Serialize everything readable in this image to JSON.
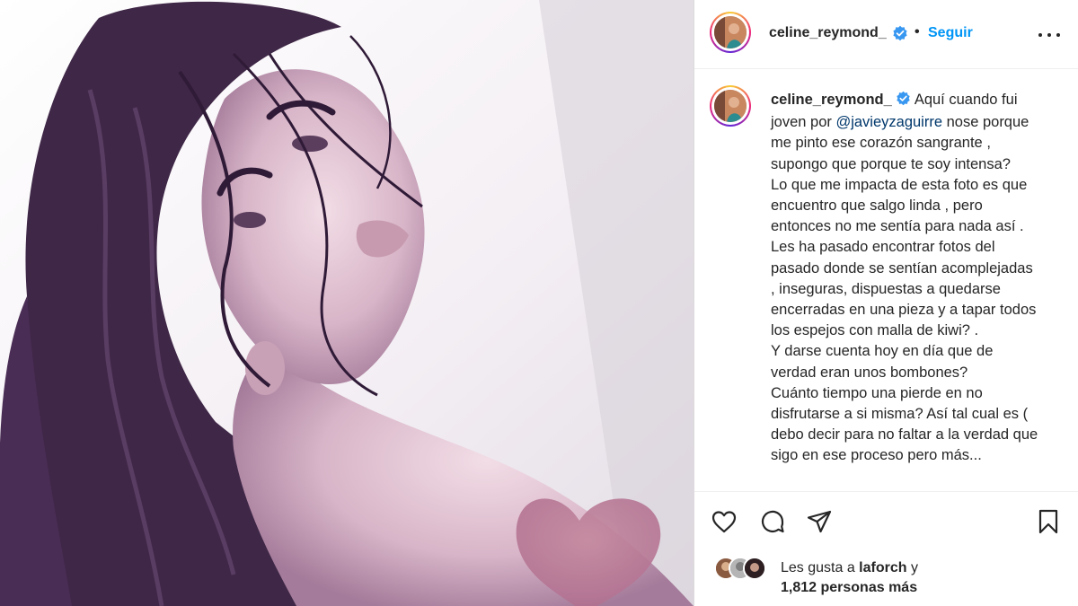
{
  "post": {
    "username": "celine_reymond_",
    "follow_separator": "•",
    "follow_label": "Seguir"
  },
  "caption": {
    "username": "celine_reymond_",
    "line1_before": "Aquí cuando fui joven por ",
    "mention": "@javieyzaguirre",
    "line1_after": " nose porque me pinto ese corazón sangrante , supongo que porque te soy intensa?",
    "para2": "Lo que me impacta de esta foto es que encuentro que salgo linda , pero entonces no me sentía para nada así . Les ha pasado encontrar fotos del pasado donde se sentían acomplejadas , inseguras, dispuestas a quedarse encerradas en una pieza y a tapar todos los espejos con malla de kiwi? .",
    "para3": "Y darse cuenta hoy en día que de verdad eran unos bombones?",
    "para4": "Cuánto tiempo una pierde en no disfrutarse a si misma? Así tal cual es ( debo decir para no faltar a la verdad que sigo en ese proceso pero más..."
  },
  "likes": {
    "prefix": "Les gusta a ",
    "user": "laforch",
    "suffix": " y",
    "count_text": "1,812 personas más"
  },
  "icons": [
    "more-options-icon",
    "verified-badge-icon",
    "heart-icon",
    "comment-icon",
    "share-icon",
    "bookmark-icon"
  ],
  "colors": {
    "link_blue": "#0095f6",
    "mention_blue": "#00376b",
    "text": "#262626",
    "verified_blue": "#3897f0"
  }
}
